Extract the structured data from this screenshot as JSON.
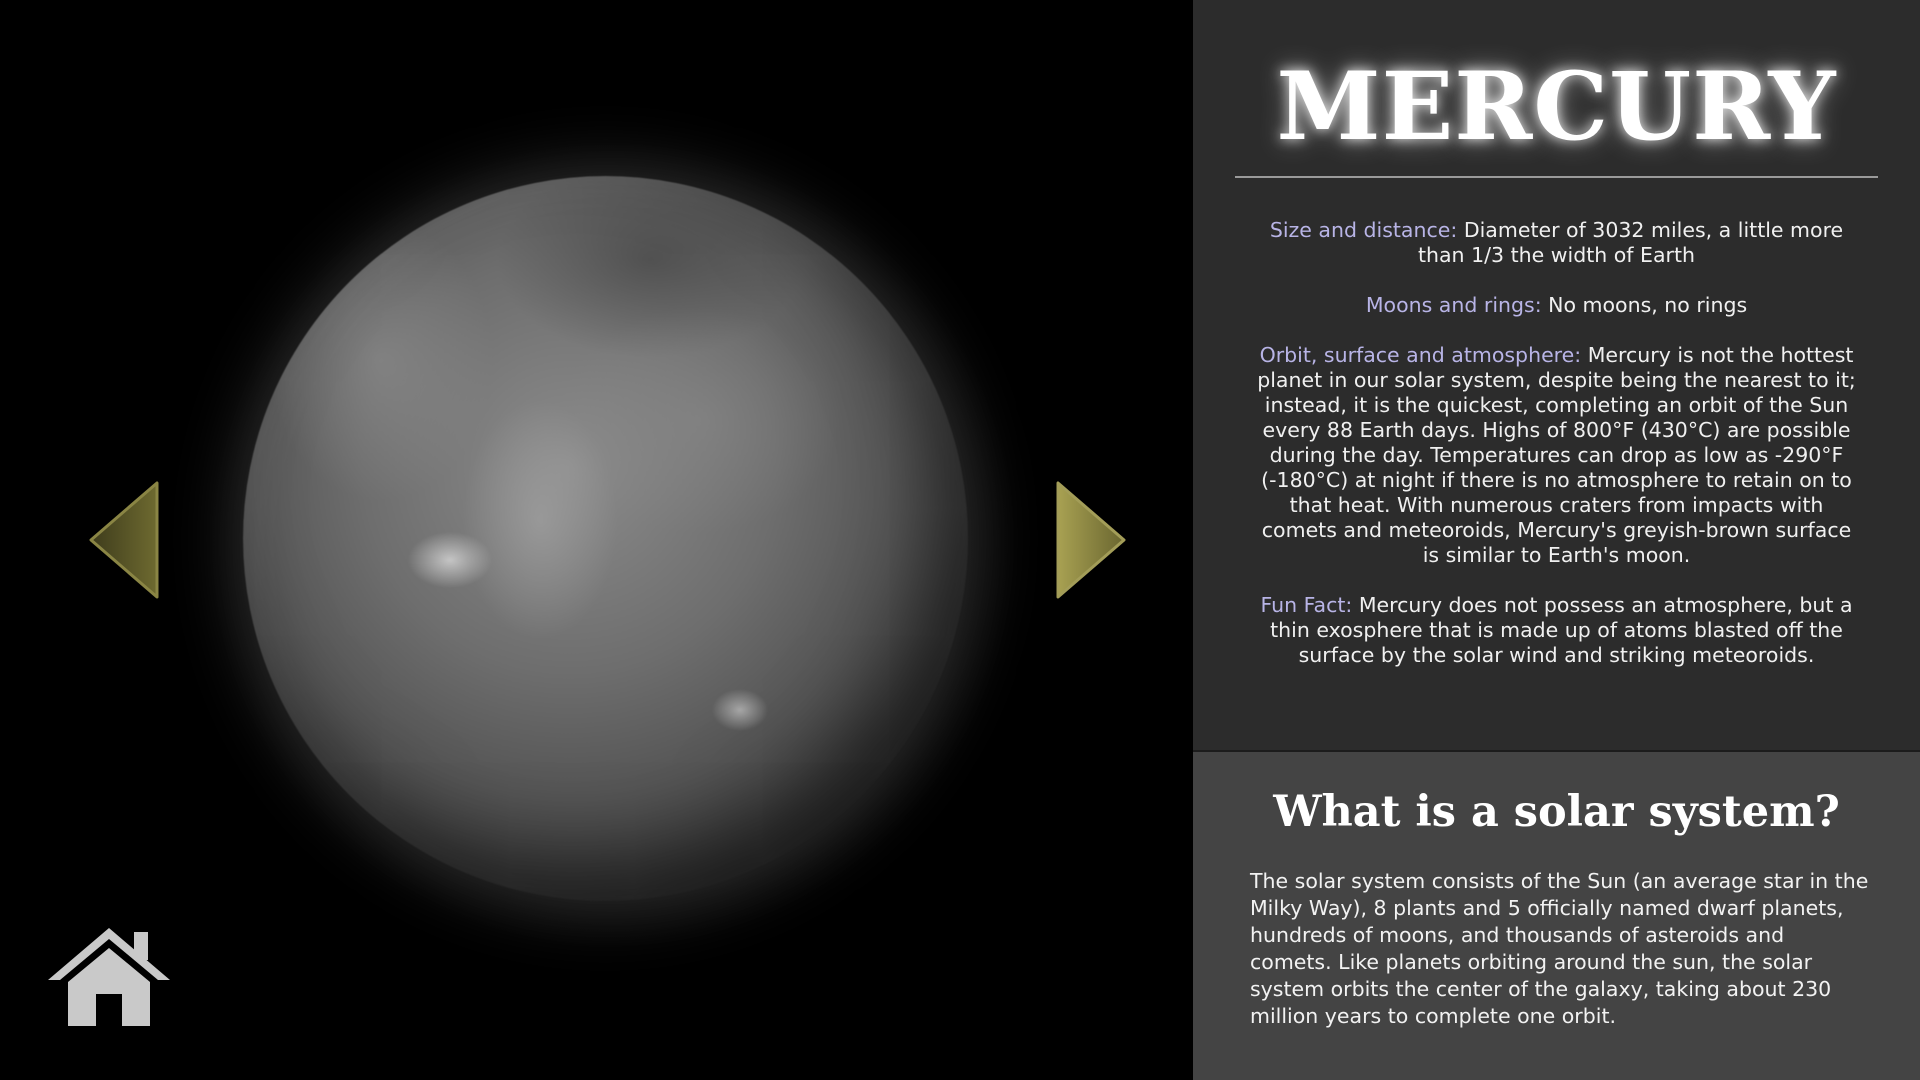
{
  "planet": {
    "name": "MERCURY",
    "image_icon": "mercury-planet-image"
  },
  "navigation": {
    "prev_icon": "triangle-left-icon",
    "next_icon": "triangle-right-icon",
    "home_icon": "house-icon",
    "arrow_color": "#7a7638"
  },
  "facts": {
    "size_label": "Size and distance:",
    "size_text": "Diameter of 3032 miles, a little more than 1/3 the width of Earth",
    "moons_label": "Moons and rings:",
    "moons_text": "No moons, no rings",
    "orbit_label": "Orbit, surface and atmosphere:",
    "orbit_text": "Mercury is not the hottest planet in our solar system, despite being the nearest to it; instead, it is the quickest, completing an orbit of the Sun every 88 Earth days. Highs of 800°F (430°C) are possible during the day. Temperatures can drop as low as -290°F (-180°C) at night if there is no atmosphere to retain on to that heat. With numerous craters from impacts with comets and meteoroids, Mercury's greyish-brown surface is similar to Earth's moon.",
    "fun_label": "Fun Fact:",
    "fun_text": "Mercury does not possess an atmosphere, but a thin exosphere that is made up of atoms blasted off the surface by the solar wind and striking meteoroids."
  },
  "solar_system": {
    "title": "What is a solar system?",
    "body": "The solar system consists of the Sun (an average star in the Milky Way), 8 plants and 5 officially named dwarf planets, hundreds of moons, and thousands of asteroids and comets. Like planets orbiting around the sun, the solar system orbits the center of the galaxy, taking about 230 million years to complete one orbit."
  },
  "colors": {
    "label_color": "#b8b4e6",
    "panel_top": "#2c2c2c",
    "panel_bottom": "#444444"
  }
}
